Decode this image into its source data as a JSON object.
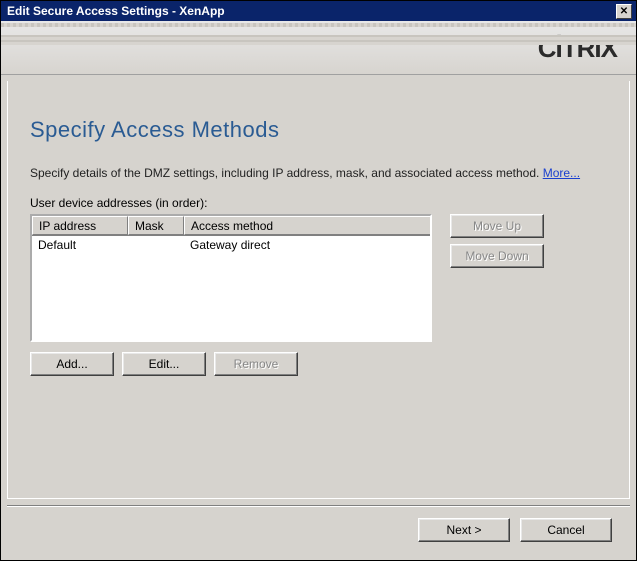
{
  "window": {
    "title": "Edit Secure Access Settings - XenApp",
    "close_glyph": "✕"
  },
  "brand": "CİTRIX",
  "page": {
    "heading": "Specify Access Methods",
    "description": "Specify details of the DMZ settings, including IP address, mask, and associated access method.",
    "more_label": "More...",
    "list_label": "User device addresses (in order):"
  },
  "columns": {
    "ip": "IP address",
    "mask": "Mask",
    "method": "Access method"
  },
  "rows": [
    {
      "ip": "Default",
      "mask": "",
      "method": "Gateway direct"
    }
  ],
  "buttons": {
    "move_up": "Move Up",
    "move_down": "Move Down",
    "add": "Add...",
    "edit": "Edit...",
    "remove": "Remove",
    "next": "Next >",
    "cancel": "Cancel"
  }
}
